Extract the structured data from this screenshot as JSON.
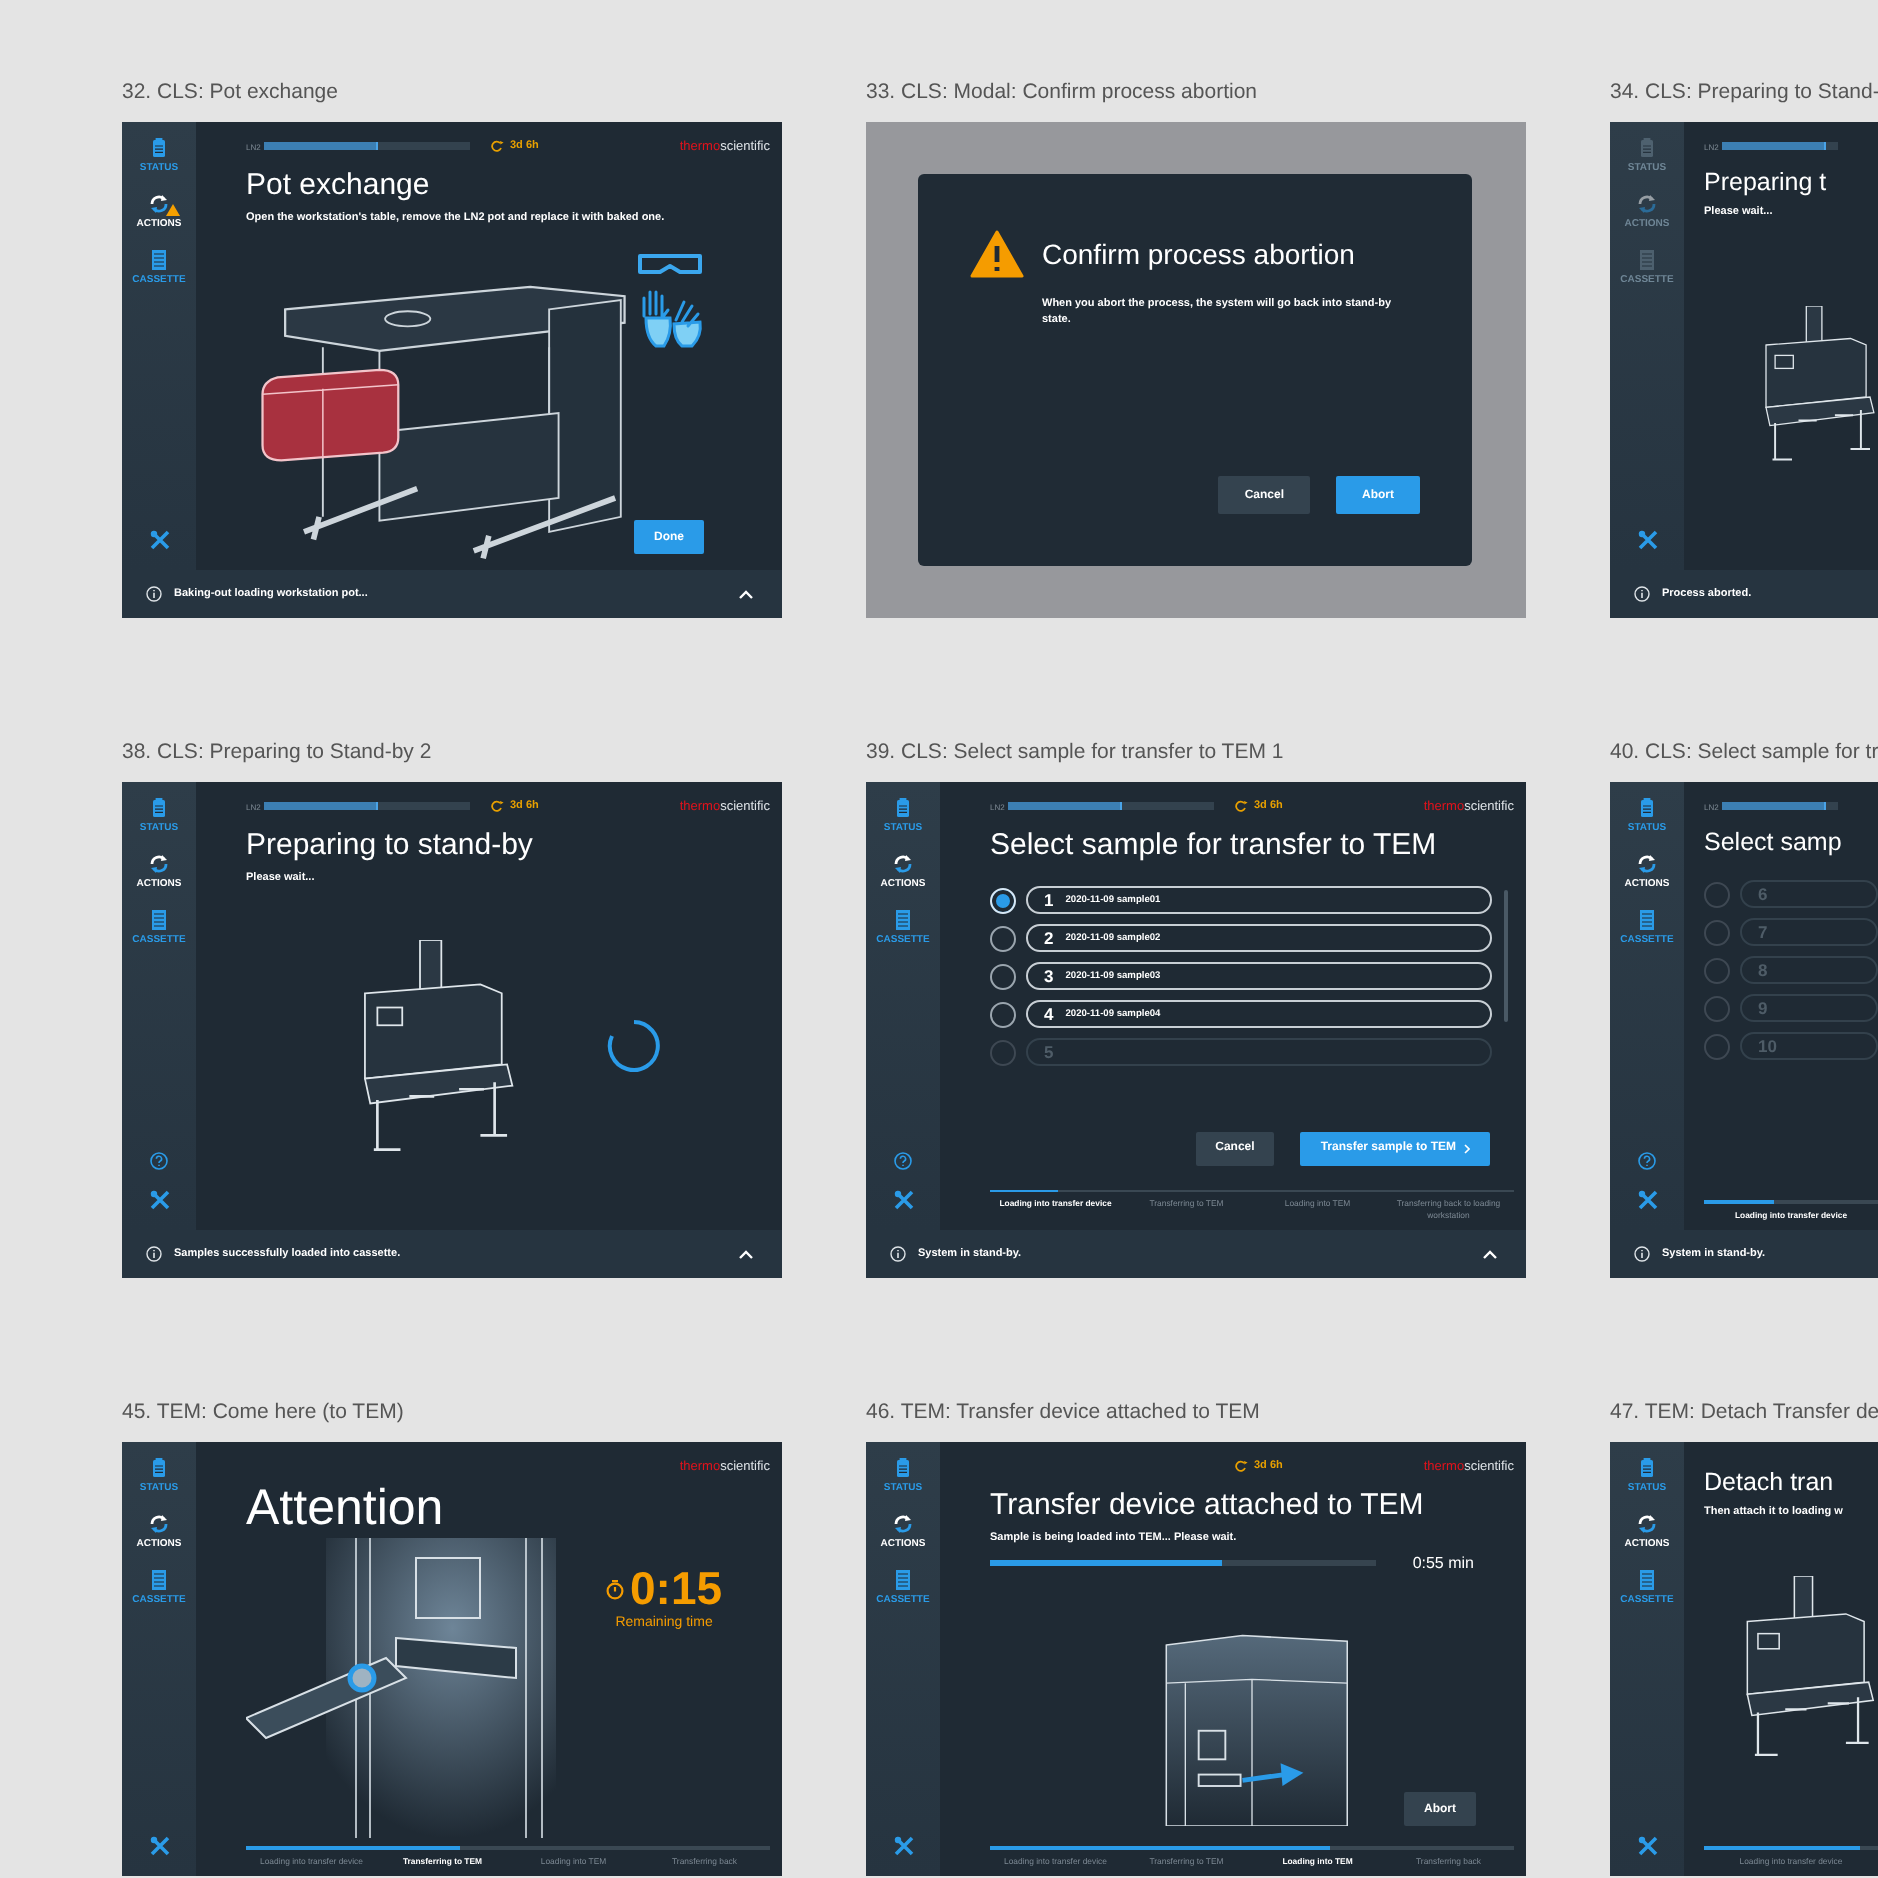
{
  "cards": [
    {
      "caption": "32. CLS: Pot exchange",
      "screen": {
        "kind": "pot",
        "nav": [
          {
            "kind": "status",
            "label": "STATUS",
            "selected": false,
            "disabled": false,
            "warning": false
          },
          {
            "kind": "actions",
            "label": "ACTIONS",
            "selected": true,
            "disabled": false,
            "warning": true
          },
          {
            "kind": "cassette",
            "label": "CASSETTE",
            "selected": false,
            "disabled": false,
            "warning": false
          }
        ],
        "ln2": {
          "label": "LN2",
          "level": 0.55
        },
        "timer": "3d 6h",
        "brand": [
          "thermo",
          "scientific"
        ],
        "title": "Pot exchange",
        "text": "Open the workstation's table, remove the LN2 pot and replace it with baked one.",
        "buttons": [
          {
            "label": "Done",
            "kind": "primary"
          }
        ],
        "footer": {
          "text": "Baking-out loading workstation pot...",
          "expand": true
        }
      }
    },
    {
      "caption": "33. CLS: Modal: Confirm process abortion",
      "screen": {
        "kind": "modal",
        "dialog": {
          "title": "Confirm process abortion",
          "text": "When you abort the process, the system will go back into stand-by state.",
          "buttons": [
            {
              "label": "Cancel",
              "kind": "secondary"
            },
            {
              "label": "Abort",
              "kind": "primary"
            }
          ]
        }
      }
    },
    {
      "caption": "34. CLS: Preparing to Stand-",
      "screen": {
        "kind": "standby",
        "nav": [
          {
            "kind": "status",
            "label": "STATUS",
            "selected": false,
            "disabled": true,
            "warning": false
          },
          {
            "kind": "actions",
            "label": "ACTIONS",
            "selected": false,
            "disabled": true,
            "warning": false
          },
          {
            "kind": "cassette",
            "label": "CASSETTE",
            "selected": false,
            "disabled": true,
            "warning": false
          }
        ],
        "ln2": {
          "label": "LN2",
          "level": 0.9
        },
        "title": "Preparing t",
        "text": "Please wait...",
        "footer": {
          "text": "Process aborted."
        }
      }
    },
    {
      "caption": "38. CLS: Preparing to Stand-by 2",
      "screen": {
        "kind": "standby",
        "nav": [
          {
            "kind": "status",
            "label": "STATUS",
            "selected": false,
            "disabled": false,
            "warning": false
          },
          {
            "kind": "actions",
            "label": "ACTIONS",
            "selected": true,
            "disabled": false,
            "warning": false
          },
          {
            "kind": "cassette",
            "label": "CASSETTE",
            "selected": false,
            "disabled": false,
            "warning": false
          }
        ],
        "help": true,
        "ln2": {
          "label": "LN2",
          "level": 0.55
        },
        "timer": "3d 6h",
        "brand": [
          "thermo",
          "scientific"
        ],
        "title": "Preparing to stand-by",
        "text": "Please wait...",
        "spinner": true,
        "footer": {
          "text": "Samples successfully loaded into cassette.",
          "expand": true
        }
      }
    },
    {
      "caption": "39. CLS: Select sample for transfer to TEM 1",
      "screen": {
        "kind": "select",
        "nav": [
          {
            "kind": "status",
            "label": "STATUS",
            "selected": false,
            "disabled": false,
            "warning": false
          },
          {
            "kind": "actions",
            "label": "ACTIONS",
            "selected": true,
            "disabled": false,
            "warning": false
          },
          {
            "kind": "cassette",
            "label": "CASSETTE",
            "selected": false,
            "disabled": false,
            "warning": false
          }
        ],
        "help": true,
        "ln2": {
          "label": "LN2",
          "level": 0.55
        },
        "timer": "3d 6h",
        "brand": [
          "thermo",
          "scientific"
        ],
        "title": "Select sample for transfer to TEM",
        "samples": [
          {
            "number": "1",
            "name": "2020-11-09 sample01",
            "selected": true,
            "disabled": false
          },
          {
            "number": "2",
            "name": "2020-11-09 sample02",
            "selected": false,
            "disabled": false
          },
          {
            "number": "3",
            "name": "2020-11-09 sample03",
            "selected": false,
            "disabled": false
          },
          {
            "number": "4",
            "name": "2020-11-09 sample04",
            "selected": false,
            "disabled": false
          },
          {
            "number": "5",
            "selected": false,
            "disabled": true
          }
        ],
        "buttons": [
          {
            "label": "Cancel",
            "kind": "secondary"
          },
          {
            "label": "Transfer sample to TEM",
            "kind": "primary"
          }
        ],
        "steps": {
          "level": 0.13,
          "items": [
            {
              "label": "Loading into transfer device",
              "selected": true
            },
            {
              "label": "Transferring to TEM",
              "selected": false
            },
            {
              "label": "Loading into TEM",
              "selected": false
            },
            {
              "label": "Transferring back to loading workstation",
              "selected": false
            }
          ]
        },
        "footer": {
          "text": "System in stand-by.",
          "expand": true
        }
      }
    },
    {
      "caption": "40. CLS: Select sample for tr",
      "screen": {
        "kind": "select",
        "nav": [
          {
            "kind": "status",
            "label": "STATUS",
            "selected": false,
            "disabled": false,
            "warning": false
          },
          {
            "kind": "actions",
            "label": "ACTIONS",
            "selected": true,
            "disabled": false,
            "warning": false
          },
          {
            "kind": "cassette",
            "label": "CASSETTE",
            "selected": false,
            "disabled": false,
            "warning": false
          }
        ],
        "help": true,
        "ln2": {
          "label": "LN2",
          "level": 0.9
        },
        "title": "Select samp",
        "samples": [
          {
            "number": "6",
            "selected": false,
            "disabled": true
          },
          {
            "number": "7",
            "selected": false,
            "disabled": true
          },
          {
            "number": "8",
            "selected": false,
            "disabled": true
          },
          {
            "number": "9",
            "selected": false,
            "disabled": true
          },
          {
            "number": "10",
            "selected": false,
            "disabled": true
          }
        ],
        "steps": {
          "level": 0.4,
          "items": [
            {
              "label": "Loading into transfer device",
              "selected": true
            }
          ]
        },
        "footer": {
          "text": "System in stand-by."
        }
      }
    },
    {
      "caption": "45. TEM: Come here (to TEM)",
      "screen": {
        "kind": "attention",
        "nav": [
          {
            "kind": "status",
            "label": "STATUS",
            "selected": false,
            "disabled": false,
            "warning": false
          },
          {
            "kind": "actions",
            "label": "ACTIONS",
            "selected": true,
            "disabled": false,
            "warning": false
          },
          {
            "kind": "cassette",
            "label": "CASSETTE",
            "selected": false,
            "disabled": false,
            "warning": false
          }
        ],
        "brand": [
          "thermo",
          "scientific"
        ],
        "title": "Attention",
        "countdown": {
          "value": "0:15",
          "caption": "Remaining time"
        },
        "steps": {
          "level": 0.41,
          "items": [
            {
              "label": "Loading into transfer device",
              "selected": false
            },
            {
              "label": "Transferring to TEM",
              "selected": true
            },
            {
              "label": "Loading into TEM",
              "selected": false
            },
            {
              "label": "Transferring back",
              "selected": false
            }
          ]
        }
      }
    },
    {
      "caption": "46. TEM: Transfer device attached to TEM",
      "screen": {
        "kind": "attached",
        "nav": [
          {
            "kind": "status",
            "label": "STATUS",
            "selected": false,
            "disabled": false,
            "warning": false
          },
          {
            "kind": "actions",
            "label": "ACTIONS",
            "selected": true,
            "disabled": false,
            "warning": false
          },
          {
            "kind": "cassette",
            "label": "CASSETTE",
            "selected": false,
            "disabled": false,
            "warning": false
          }
        ],
        "timer": "3d 6h",
        "brand": [
          "thermo",
          "scientific"
        ],
        "title": "Transfer device attached to TEM",
        "text": "Sample is being loaded into TEM... Please wait.",
        "progress": {
          "level": 0.6,
          "reading": "0:55 min"
        },
        "buttons": [
          {
            "label": "Abort",
            "kind": "secondary"
          }
        ],
        "steps": {
          "level": 0.65,
          "items": [
            {
              "label": "Loading into transfer device",
              "selected": false
            },
            {
              "label": "Transferring to TEM",
              "selected": false
            },
            {
              "label": "Loading into TEM",
              "selected": true
            },
            {
              "label": "Transferring back",
              "selected": false
            }
          ]
        }
      }
    },
    {
      "caption": "47. TEM: Detach Transfer de",
      "screen": {
        "kind": "detach",
        "nav": [
          {
            "kind": "status",
            "label": "STATUS",
            "selected": false,
            "disabled": false,
            "warning": false
          },
          {
            "kind": "actions",
            "label": "ACTIONS",
            "selected": true,
            "disabled": false,
            "warning": false
          },
          {
            "kind": "cassette",
            "label": "CASSETTE",
            "selected": false,
            "disabled": false,
            "warning": false
          }
        ],
        "title": "Detach tran",
        "text": "Then attach it to loading w",
        "steps": {
          "level": 0.9,
          "items": [
            {
              "label": "Loading into transfer device",
              "selected": false
            }
          ]
        }
      }
    }
  ]
}
